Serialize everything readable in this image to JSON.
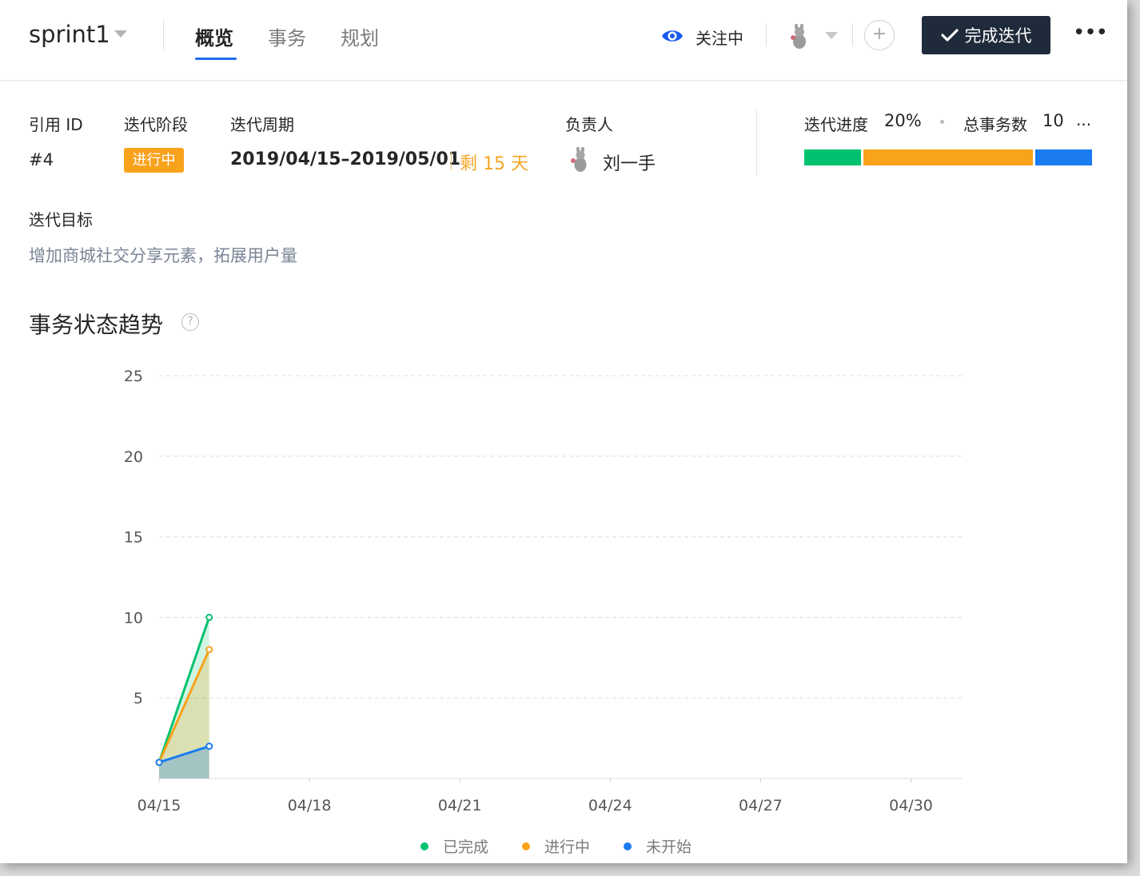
{
  "header": {
    "sprint_name": "sprint1",
    "tabs": [
      {
        "label": "概览",
        "active": true
      },
      {
        "label": "事务",
        "active": false
      },
      {
        "label": "规划",
        "active": false
      }
    ],
    "watch_label": "关注中",
    "add_label": "+",
    "complete_label": "完成迭代",
    "more_label": "•••"
  },
  "info": {
    "ref_id_label": "引用 ID",
    "ref_id_value": "#4",
    "stage_label": "迭代阶段",
    "stage_value": "进行中",
    "period_label": "迭代周期",
    "period_value": "2019/04/15–2019/05/01",
    "remaining": "剩 15 天",
    "owner_label": "负责人",
    "owner_name": "刘一手",
    "progress_label": "迭代进度",
    "progress_value": "20%",
    "total_label": "总事务数",
    "total_value": "10",
    "more": "..."
  },
  "progress_bar": [
    {
      "name": "已完成",
      "fraction": 0.2,
      "color": "#00c170"
    },
    {
      "name": "进行中",
      "fraction": 0.6,
      "color": "#f9a21b"
    },
    {
      "name": "未开始",
      "fraction": 0.2,
      "color": "#1a7cf0"
    }
  ],
  "goal": {
    "label": "迭代目标",
    "text": "增加商城社交分享元素，拓展用户量"
  },
  "section": {
    "title": "事务状态趋势",
    "help_icon": "question-circle-icon"
  },
  "chart_data": {
    "type": "area",
    "title": "事务状态趋势",
    "x_ticks": [
      "04/15",
      "04/18",
      "04/21",
      "04/24",
      "04/27",
      "04/30"
    ],
    "x_tick_days": [
      0,
      3,
      6,
      9,
      12,
      15
    ],
    "y_ticks": [
      "25",
      "20",
      "15",
      "10",
      "5"
    ],
    "ylim": [
      0,
      25
    ],
    "grid": "horizontal dashed",
    "legend_position": "bottom-center",
    "series": [
      {
        "name": "已完成",
        "color": "#00c170",
        "x": [
          "04/15",
          "04/16"
        ],
        "values": [
          1,
          10
        ]
      },
      {
        "name": "进行中",
        "color": "#f9a21b",
        "x": [
          "04/15",
          "04/16"
        ],
        "values": [
          1,
          8
        ]
      },
      {
        "name": "未开始",
        "color": "#1a7cf0",
        "x": [
          "04/15",
          "04/16"
        ],
        "values": [
          1,
          2
        ]
      }
    ]
  }
}
